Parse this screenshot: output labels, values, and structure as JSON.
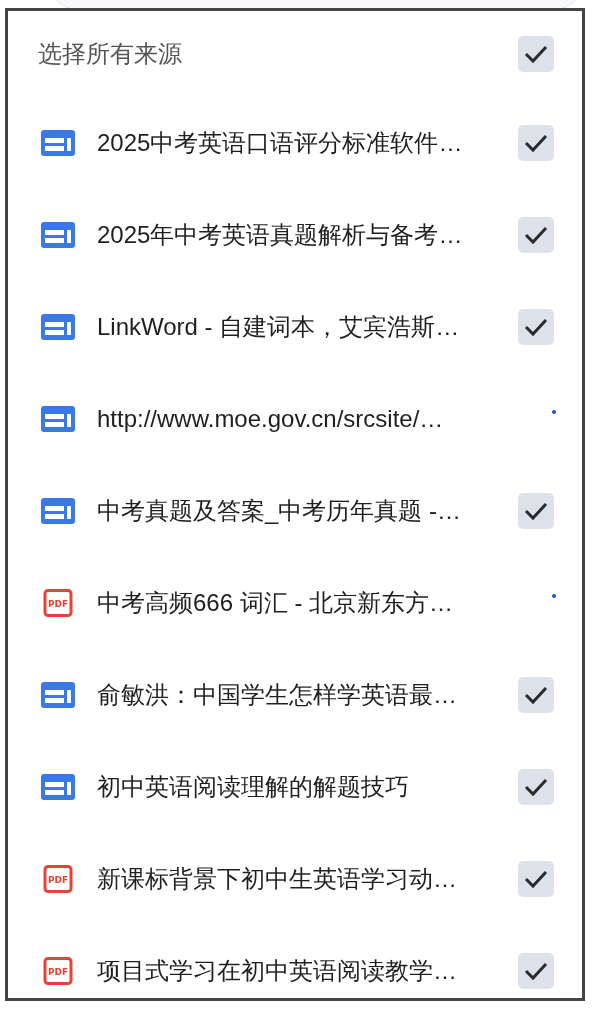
{
  "select_all": {
    "label": "选择所有来源",
    "checked": true
  },
  "sources": [
    {
      "kind": "web",
      "title": "2025中考英语口语评分标准软件…",
      "checked": true
    },
    {
      "kind": "web",
      "title": "2025年中考英语真题解析与备考…",
      "checked": true
    },
    {
      "kind": "web",
      "title": "LinkWord - 自建词本，艾宾浩斯…",
      "checked": true
    },
    {
      "kind": "web",
      "title": "http://www.moe.gov.cn/srcsite/…",
      "checked": false
    },
    {
      "kind": "web",
      "title": "中考真题及答案_中考历年真题 -…",
      "checked": true
    },
    {
      "kind": "pdf",
      "icon_label": "PDF",
      "title": "中考高频666 词汇 - 北京新东方…",
      "checked": false
    },
    {
      "kind": "web",
      "title": "俞敏洪：中国学生怎样学英语最…",
      "checked": true
    },
    {
      "kind": "web",
      "title": "初中英语阅读理解的解题技巧",
      "checked": true
    },
    {
      "kind": "pdf",
      "icon_label": "PDF",
      "title": "新课标背景下初中生英语学习动…",
      "checked": true
    },
    {
      "kind": "pdf",
      "icon_label": "PDF",
      "title": "项目式学习在初中英语阅读教学…",
      "checked": true
    }
  ]
}
